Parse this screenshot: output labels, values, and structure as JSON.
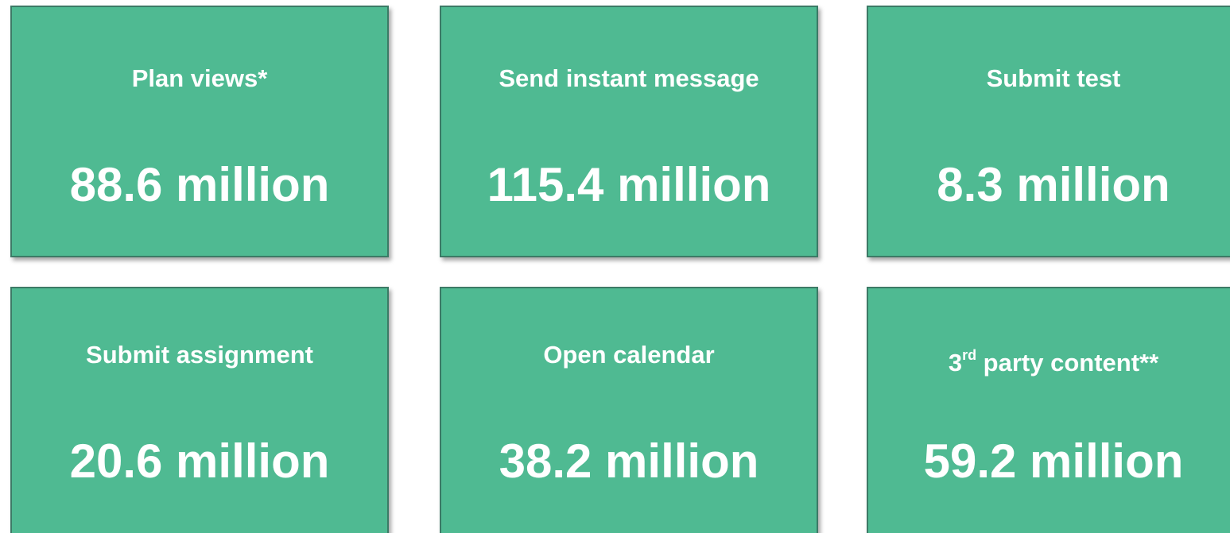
{
  "tiles": [
    {
      "label": "Plan views*",
      "value": "88.6 million"
    },
    {
      "label": "Send instant message",
      "value": "115.4 million"
    },
    {
      "label": "Submit test",
      "value": "8.3 million"
    },
    {
      "label": "Submit assignment",
      "value": "20.6 million"
    },
    {
      "label": "Open calendar",
      "value": "38.2 million"
    },
    {
      "label_prefix": "3",
      "label_sup": "rd",
      "label_suffix": " party content**",
      "value": "59.2 million"
    }
  ],
  "colors": {
    "tile_background": "#4fba92",
    "tile_border": "#3c7a66",
    "text": "#ffffff"
  }
}
